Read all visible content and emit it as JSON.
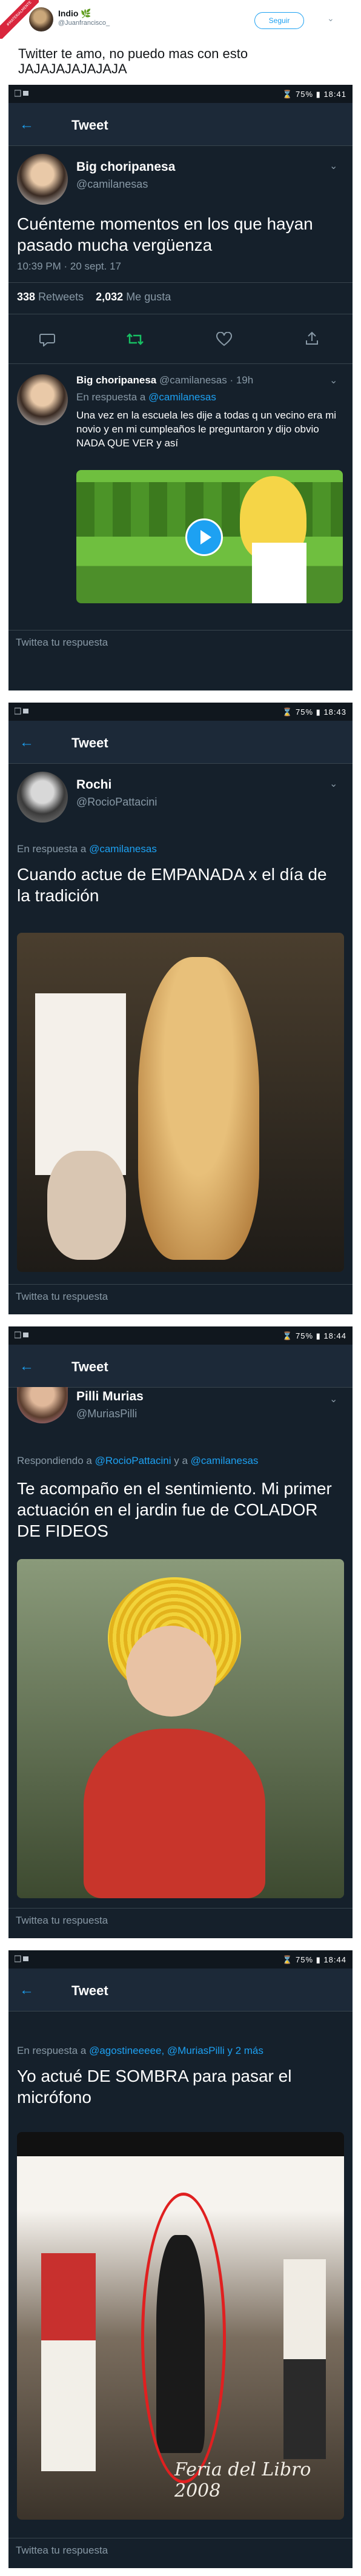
{
  "ribbon_text": "#MATERIALMENTE",
  "outer": {
    "name": "Indio",
    "name_emoji": "🌿",
    "handle": "@Juanfrancisco_",
    "follow_label": "Seguir",
    "text": "Twitter te amo, no puedo mas con esto JAJAJAJAJAJAJA"
  },
  "screens": [
    {
      "status_time": "18:41",
      "battery": "75%",
      "nav_title": "Tweet",
      "main_tweet": {
        "name": "Big choripanesa",
        "handle": "@camilanesas",
        "text": "Cuénteme momentos en los que hayan pasado mucha vergüenza",
        "timestamp": "10:39 PM · 20 sept. 17",
        "retweets_count": "338",
        "retweets_label": "Retweets",
        "likes_count": "2,032",
        "likes_label": "Me gusta"
      },
      "reply_tweet": {
        "name": "Big choripanesa",
        "handle": "@camilanesas · 19h",
        "in_reply_prefix": "En respuesta a",
        "in_reply_mention": "@camilanesas",
        "text": "Una vez en la escuela les dije a todas q un vecino era mi novio y en mi cumpleaños le preguntaron y dijo obvio NADA QUE VER y así"
      },
      "reply_placeholder": "Twittea tu respuesta"
    },
    {
      "status_time": "18:43",
      "battery": "75%",
      "nav_title": "Tweet",
      "tweet": {
        "name": "Rochi",
        "handle": "@RocioPattacini",
        "in_reply_prefix": "En respuesta a",
        "in_reply_mention": "@camilanesas",
        "text": "Cuando actue de EMPANADA x el día de la tradición"
      },
      "reply_placeholder": "Twittea tu respuesta"
    },
    {
      "status_time": "18:44",
      "battery": "75%",
      "nav_title": "Tweet",
      "tweet": {
        "name": "Pilli Murias",
        "handle": "@MuriasPilli",
        "in_reply_prefix": "Respondiendo a",
        "in_reply_mention": "@RocioPattacini",
        "in_reply_and": "y a",
        "in_reply_mention2": "@camilanesas",
        "text": "Te acompaño en el sentimiento. Mi primer actuación en el jardin fue de COLADOR DE FIDEOS"
      },
      "reply_placeholder": "Twittea tu respuesta"
    },
    {
      "status_time": "18:44",
      "battery": "75%",
      "nav_title": "Tweet",
      "tweet": {
        "in_reply_prefix": "En respuesta a",
        "in_reply_mention": "@agostineeeee,",
        "in_reply_mention2": "@MuriasPilli",
        "in_reply_more": "y 2 más",
        "text": "Yo actué DE SOMBRA para pasar el micrófono",
        "photo_caption": "Feria del Libro 2008"
      },
      "reply_placeholder": "Twittea tu respuesta"
    }
  ],
  "colors": {
    "panel_bg": "#15202b",
    "accent": "#1da1f2",
    "muted": "#8899a6",
    "retweet_green": "#17bf63"
  },
  "icons": [
    "back-arrow-icon",
    "chevron-down-icon",
    "reply-icon",
    "retweet-icon",
    "like-icon",
    "share-icon",
    "play-icon",
    "wifi-icon",
    "battery-icon"
  ]
}
